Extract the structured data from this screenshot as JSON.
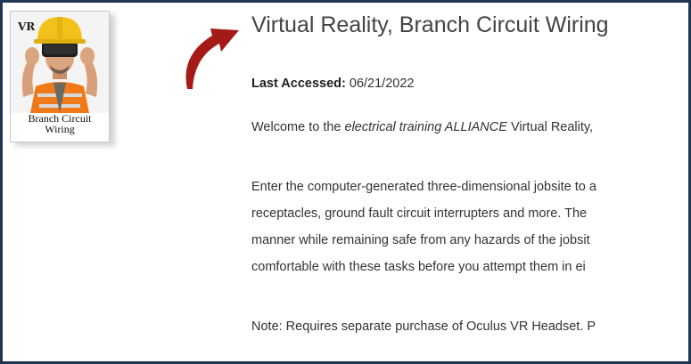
{
  "course": {
    "title": "Virtual Reality, Branch Circuit Wiring",
    "last_accessed_label": "Last Accessed:",
    "last_accessed_value": "06/21/2022"
  },
  "thumbnail": {
    "badge": "VR",
    "caption_line1": "Branch Circuit",
    "caption_line2": "Wiring"
  },
  "description": {
    "welcome_prefix": "Welcome to the ",
    "welcome_italic": "electrical training ALLIANCE",
    "welcome_suffix": " Virtual Reality,",
    "lines": [
      "Enter the computer-generated three-dimensional jobsite to a",
      "receptacles, ground fault circuit interrupters and more. The",
      "manner while remaining safe from any hazards of the jobsit",
      "comfortable with these tasks before you attempt them in ei"
    ],
    "note": "Note: Requires separate purchase of Oculus VR Headset. P"
  },
  "colors": {
    "frame": "#1f3551",
    "arrow": "#a31a16",
    "helmet": "#f2c21b",
    "vest": "#f07a1a"
  },
  "icons": {
    "arrow": "curved-arrow-icon",
    "thumbnail": "vr-worker-image"
  }
}
